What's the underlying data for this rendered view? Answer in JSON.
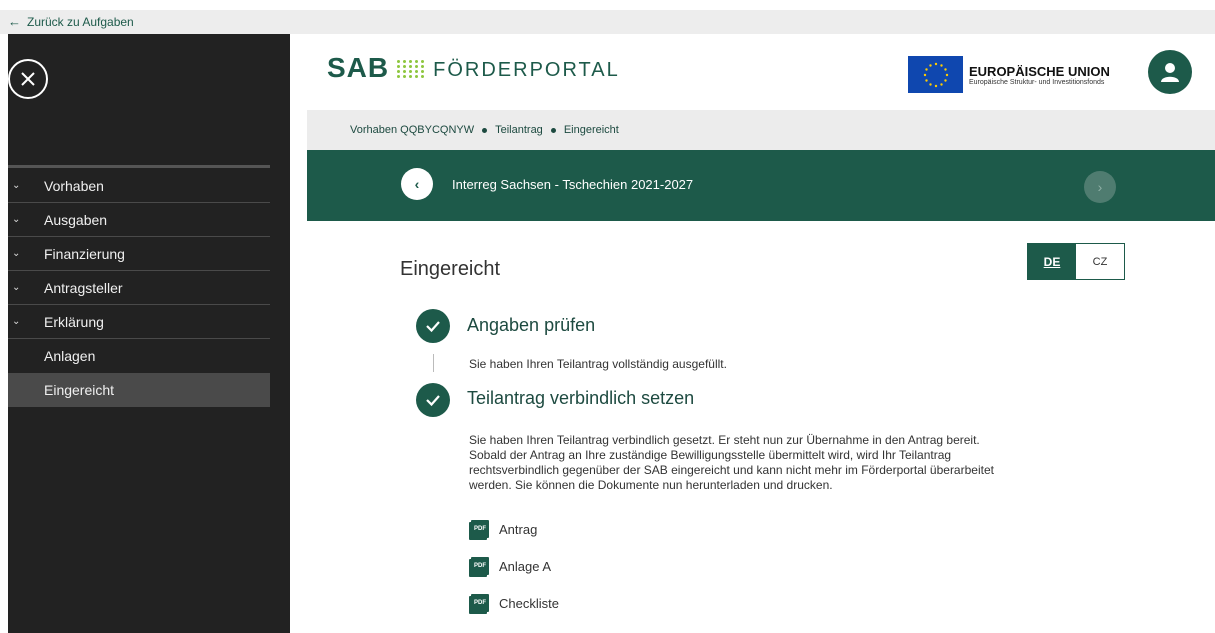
{
  "topbar": {
    "back_label": "Zurück zu Aufgaben"
  },
  "sidebar": {
    "items": [
      {
        "label": "Vorhaben"
      },
      {
        "label": "Ausgaben"
      },
      {
        "label": "Finanzierung"
      },
      {
        "label": "Antragsteller"
      },
      {
        "label": "Erklärung"
      },
      {
        "label": "Anlagen"
      },
      {
        "label": "Eingereicht"
      }
    ]
  },
  "header": {
    "logo_sab": "SAB",
    "logo_portal": "FÖRDERPORTAL",
    "eu_title": "EUROPÄISCHE UNION",
    "eu_subtitle": "Europäische Struktur- und Investitionsfonds"
  },
  "breadcrumb": {
    "items": [
      "Vorhaben QQBYCQNYW",
      "Teilantrag",
      "Eingereicht"
    ]
  },
  "banner": {
    "title": "Interreg Sachsen - Tschechien 2021-2027"
  },
  "main": {
    "heading": "Eingereicht",
    "languages": {
      "active": "DE",
      "other": "CZ"
    },
    "steps": [
      {
        "title": "Angaben prüfen",
        "text": "Sie haben Ihren Teilantrag vollständig ausgefüllt."
      },
      {
        "title": "Teilantrag verbindlich setzen",
        "text_lines": [
          "Sie haben Ihren Teilantrag verbindlich gesetzt. Er steht nun zur Übernahme in den Antrag bereit.",
          "Sobald der Antrag an Ihre zuständige Bewilligungsstelle übermittelt wird, wird Ihr Teilantrag",
          "rechtsverbindlich gegenüber der SAB eingereicht und kann nicht mehr im Förderportal überarbeitet",
          "werden. Sie können die Dokumente nun herunterladen und drucken."
        ]
      }
    ],
    "documents": [
      {
        "label": "Antrag",
        "icon": "PDF"
      },
      {
        "label": "Anlage A",
        "icon": "PDF"
      },
      {
        "label": "Checkliste",
        "icon": "PDF"
      }
    ]
  },
  "colors": {
    "primary": "#1d5a4a",
    "sidebar": "#222222",
    "accent_dots": "#8ec63f",
    "eu_blue": "#0f47af"
  }
}
